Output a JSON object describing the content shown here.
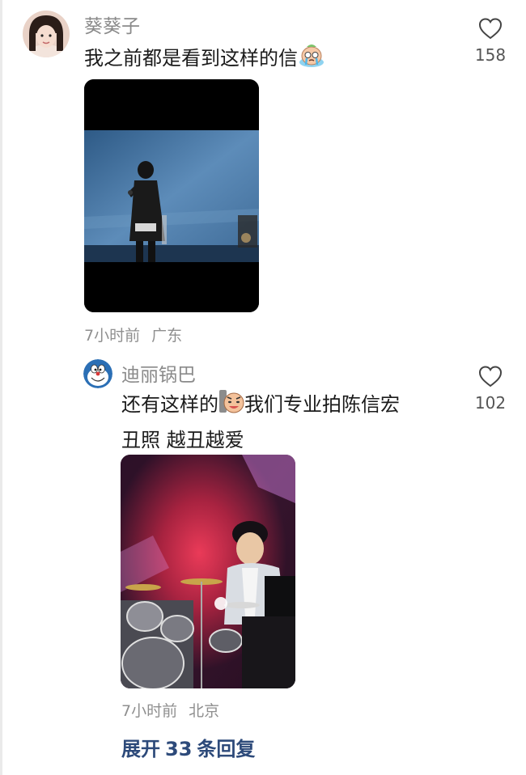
{
  "comments": [
    {
      "username": "葵葵子",
      "text": "我之前都是看到这样的信",
      "time": "7小时前",
      "location": "广东",
      "likes": "158"
    },
    {
      "username": "迪丽锅巴",
      "text_line1": "还有这样的",
      "text_line1b": "我们专业拍陈信宏",
      "text_line2": "丑照 越丑越爱",
      "time": "7小时前",
      "location": "北京",
      "likes": "102"
    }
  ],
  "expand": {
    "prefix": "展开",
    "count": "33",
    "suffix": "条回复"
  },
  "colors": {
    "username": "#8a8a8a",
    "link": "#2d4a7a",
    "meta": "#8f8f8f"
  },
  "icons": [
    "heart-outline-icon",
    "crying-face-emoji",
    "laughing-face-emoji"
  ]
}
